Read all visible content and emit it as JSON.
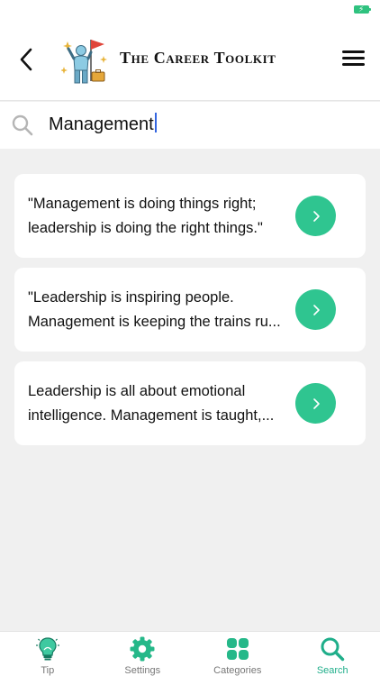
{
  "colors": {
    "accent": "#2fc590",
    "tab_active": "#1fae8a",
    "tab_inactive": "#777777",
    "caret": "#3466e0",
    "background": "#f0f0f0"
  },
  "header": {
    "title": "The Career Toolkit",
    "back_icon": "chevron-left-icon",
    "menu_icon": "hamburger-menu-icon"
  },
  "search": {
    "value": "Management",
    "icon": "search-icon"
  },
  "results": [
    {
      "line1": "\"Management is doing things right;",
      "line2": "leadership is doing the right things.\""
    },
    {
      "line1": "\"Leadership is inspiring people.",
      "line2": "Management is keeping the trains ru..."
    },
    {
      "line1": "Leadership is all about emotional",
      "line2": "intelligence. Management is taught,..."
    }
  ],
  "tabs": [
    {
      "label": "Tip",
      "icon": "lightbulb-icon",
      "active": false
    },
    {
      "label": "Settings",
      "icon": "gear-icon",
      "active": false
    },
    {
      "label": "Categories",
      "icon": "grid-icon",
      "active": false
    },
    {
      "label": "Search",
      "icon": "search-icon",
      "active": true
    }
  ]
}
